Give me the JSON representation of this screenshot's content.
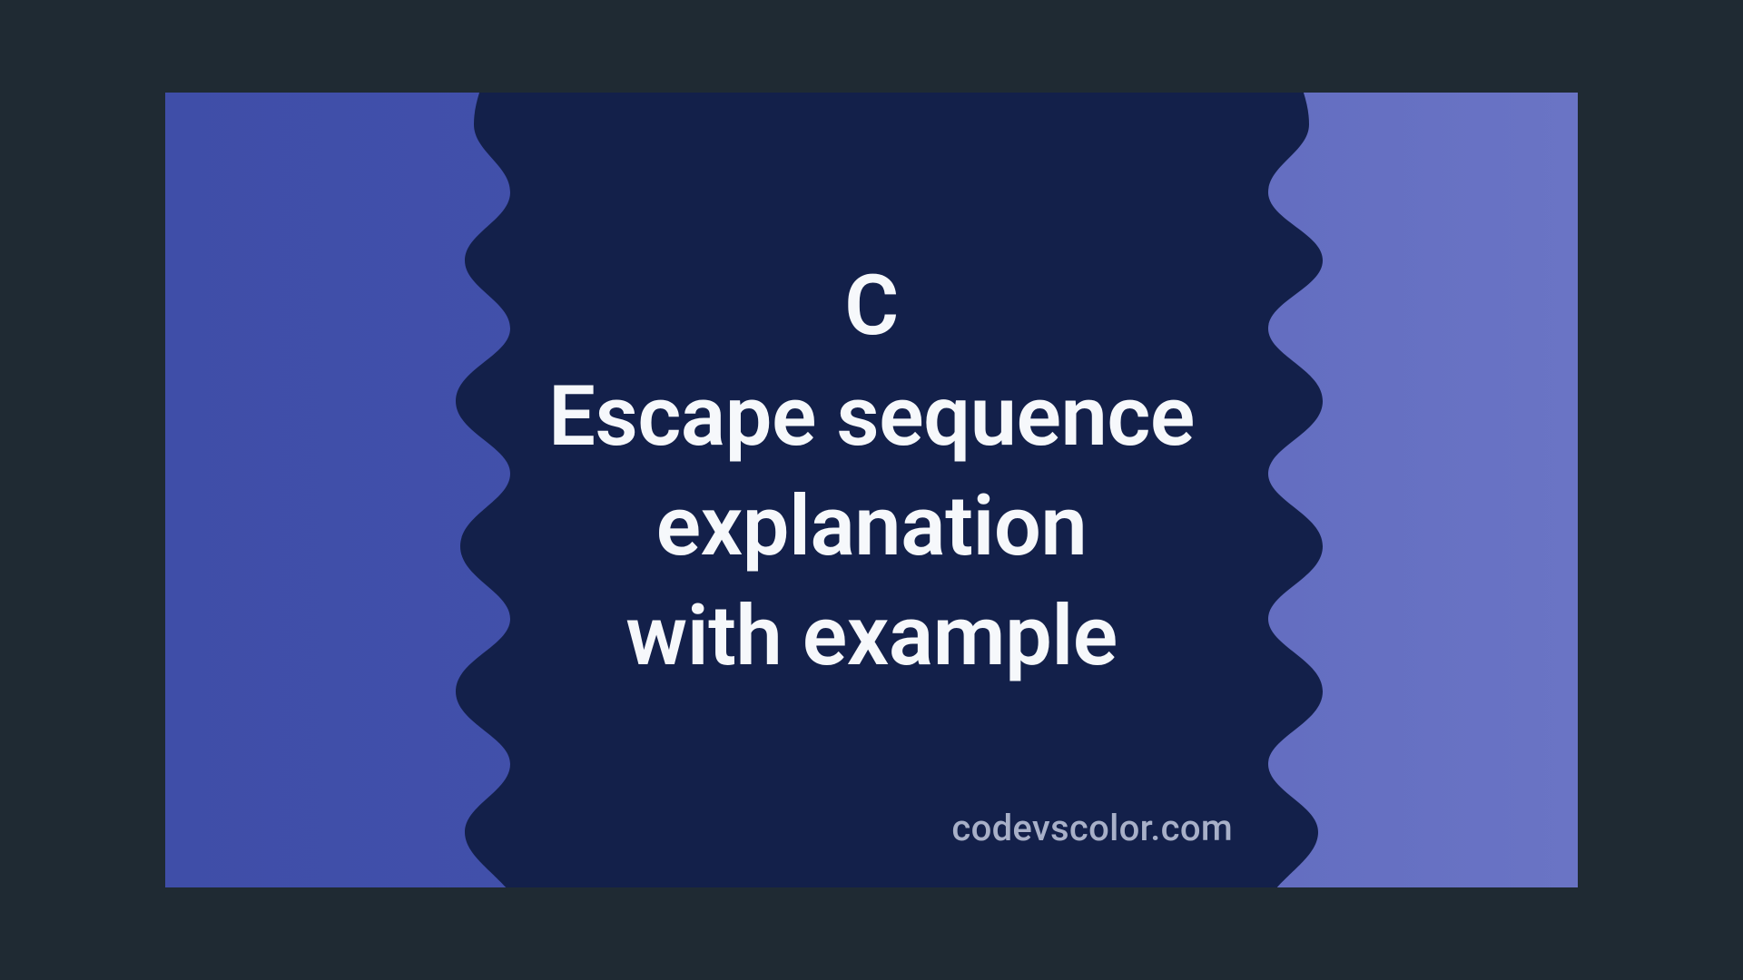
{
  "banner": {
    "title": "C",
    "subtitle_line1": "Escape sequence",
    "subtitle_line2": "explanation",
    "subtitle_line3": "with example",
    "watermark": "codevscolor.com"
  },
  "colors": {
    "bg_left_start": "#3f4ea8",
    "bg_left_end": "#4754ae",
    "bg_right_start": "#5b66bb",
    "bg_right_end": "#6a74c5",
    "blob": "#13204a",
    "text": "#f6f8fb",
    "watermark": "#a8b0c8"
  }
}
